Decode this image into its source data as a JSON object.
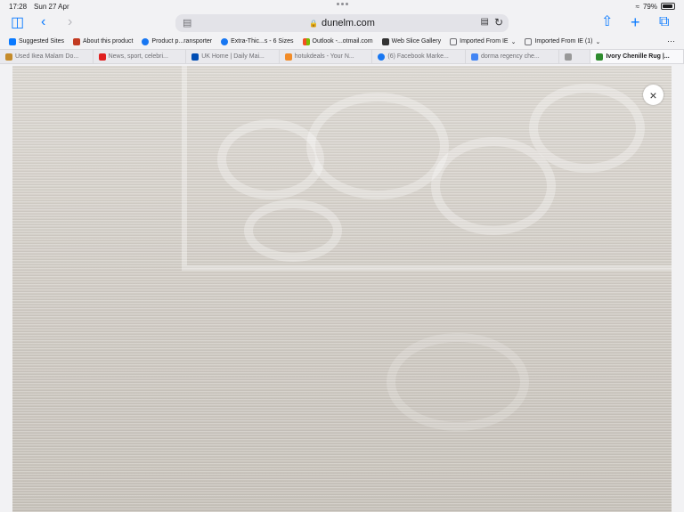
{
  "status": {
    "time": "17:28",
    "date": "Sun 27 Apr",
    "battery": "79%",
    "battery_level": 0.79
  },
  "toolbar": {
    "url": "dunelm.com"
  },
  "icons": {
    "sidebar": "sidebar-icon",
    "back": "back-icon",
    "forward": "forward-icon",
    "reader": "reader-icon",
    "lock": "lock-icon",
    "translate": "translate-icon",
    "reload": "reload-icon",
    "share": "share-icon",
    "new_tab": "plus-icon",
    "tabs": "tabs-icon"
  },
  "favorites": [
    {
      "label": "Suggested Sites",
      "color": "#0a7aff"
    },
    {
      "label": "About this product",
      "color": "#c23b22"
    },
    {
      "label": "Product p...ransporter",
      "color": "#1877f2"
    },
    {
      "label": "Extra-Thic...s - 6 Sizes",
      "color": "#1877f2"
    },
    {
      "label": "Outlook -...otmail.com",
      "color": "#f25022"
    },
    {
      "label": "Web Slice Gallery",
      "color": "#333333"
    },
    {
      "label": "Imported From IE",
      "color": "#6e6e73"
    },
    {
      "label": "Imported From IE (1)",
      "color": "#6e6e73"
    }
  ],
  "tabs": [
    {
      "label": "Used Ikea Malam Do...",
      "color": "#c58b2a",
      "active": false
    },
    {
      "label": "News, sport, celebri...",
      "color": "#e02020",
      "active": false
    },
    {
      "label": "UK Home | Daily Mai...",
      "color": "#004db3",
      "active": false
    },
    {
      "label": "hotukdeals - Your N...",
      "color": "#f28c28",
      "active": false
    },
    {
      "label": "(6) Facebook Marke...",
      "color": "#1877f2",
      "active": false
    },
    {
      "label": "dorma regency che...",
      "color": "#4285f4",
      "active": false
    },
    {
      "label": "",
      "color": "#999999",
      "active": false
    },
    {
      "label": "Ivory Chenille Rug |...",
      "color": "#2e8b2e",
      "active": true
    }
  ],
  "close": {
    "label": "×"
  }
}
